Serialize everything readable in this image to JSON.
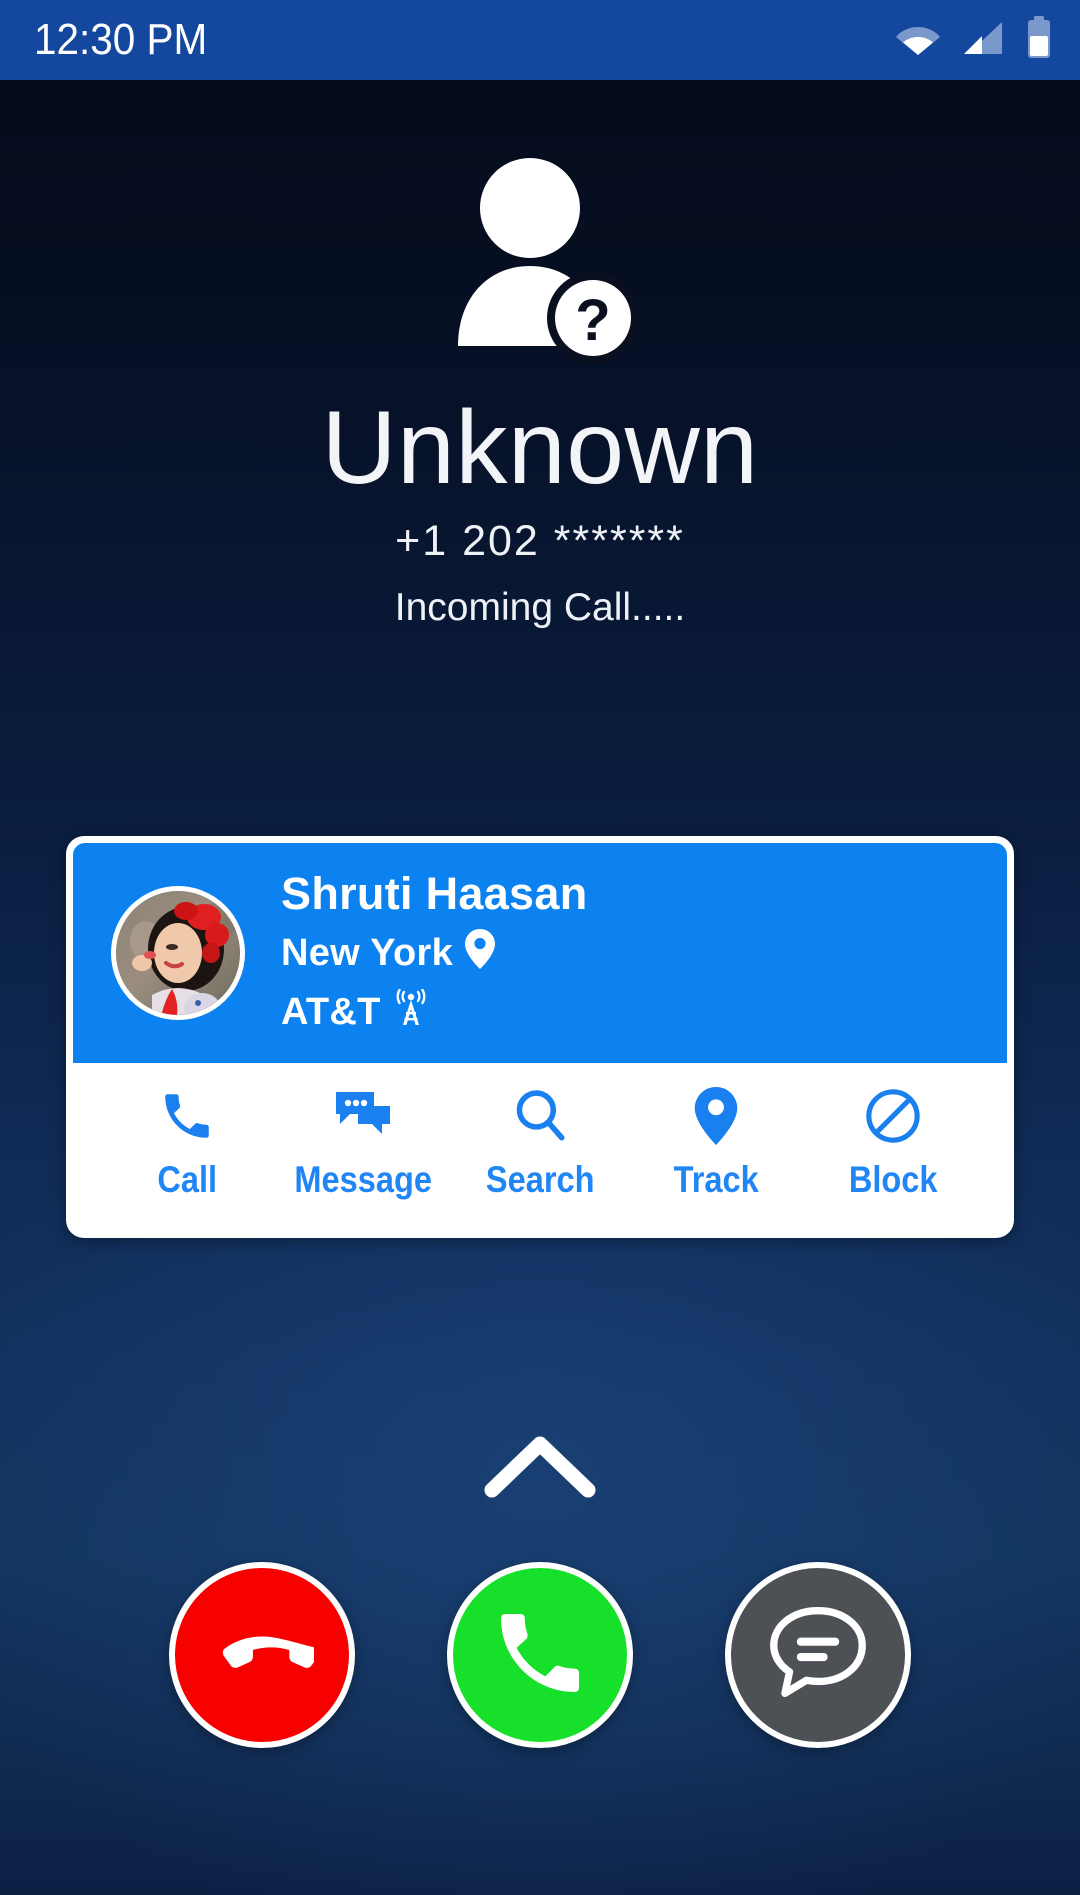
{
  "statusbar": {
    "time": "12:30 PM",
    "icons": [
      "wifi-icon",
      "cellular-signal-icon",
      "battery-icon"
    ]
  },
  "caller": {
    "avatar_icon": "unknown-person-question-icon",
    "name": "Unknown",
    "number": "+1 202 *******",
    "status": "Incoming Call....."
  },
  "contact_card": {
    "photo_alt": "contact-photo",
    "name": "Shruti Haasan",
    "location": "New York",
    "location_icon": "location-pin-icon",
    "carrier": "AT&T",
    "carrier_icon": "cell-tower-icon",
    "actions": [
      {
        "label": "Call",
        "icon": "phone-icon"
      },
      {
        "label": "Message",
        "icon": "chat-bubbles-icon"
      },
      {
        "label": "Search",
        "icon": "magnifier-icon"
      },
      {
        "label": "Track",
        "icon": "location-pin-icon"
      },
      {
        "label": "Block",
        "icon": "block-circle-slash-icon"
      }
    ]
  },
  "expand_handle": {
    "icon": "chevron-up-icon"
  },
  "call_buttons": [
    {
      "name": "decline-call-button",
      "icon": "phone-down-icon",
      "color": "#f70000"
    },
    {
      "name": "accept-call-button",
      "icon": "phone-icon",
      "color": "#17e02a"
    },
    {
      "name": "message-reply-button",
      "icon": "chat-bubble-icon",
      "color": "#4d5155"
    }
  ],
  "colors": {
    "statusbar_bg": "#14479e",
    "card_blue": "#0b82f0",
    "action_blue": "#2186f5",
    "decline_red": "#f70000",
    "accept_green": "#17e02a",
    "message_gray": "#4d5155"
  }
}
